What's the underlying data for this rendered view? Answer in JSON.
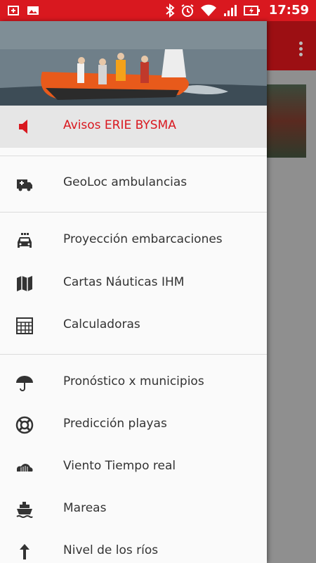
{
  "status_bar": {
    "time": "17:59",
    "icons": [
      "usb-icon",
      "gallery-icon",
      "bluetooth-icon",
      "alarm-icon",
      "wifi-icon",
      "signal-icon",
      "battery-charging-icon"
    ]
  },
  "colors": {
    "primary": "#d9181f",
    "primary_dark": "#9c0f13",
    "active_bg": "#e6e6e6"
  },
  "drawer": {
    "items": [
      {
        "label": "Avisos ERIE BYSMA",
        "icon": "megaphone-icon",
        "active": true
      },
      {
        "label": "GeoLoc ambulancias",
        "icon": "ambulance-icon"
      },
      {
        "label": "Proyección embarcaciones",
        "icon": "taxi-icon"
      },
      {
        "label": "Cartas Náuticas IHM",
        "icon": "map-icon"
      },
      {
        "label": "Calculadoras",
        "icon": "calculator-icon"
      },
      {
        "label": "Pronóstico x municipios",
        "icon": "umbrella-icon"
      },
      {
        "label": "Predicción playas",
        "icon": "lifebuoy-icon"
      },
      {
        "label": "Viento Tiempo real",
        "icon": "cloud-icon"
      },
      {
        "label": "Mareas",
        "icon": "ship-icon"
      },
      {
        "label": "Nivel de los ríos",
        "icon": "arrow-up-icon"
      }
    ]
  }
}
